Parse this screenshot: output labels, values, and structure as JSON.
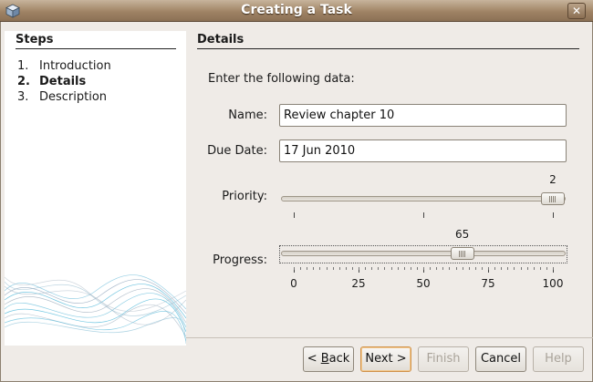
{
  "window": {
    "title": "Creating a Task",
    "close_glyph": "✕"
  },
  "steps": {
    "title": "Steps",
    "items": [
      {
        "num": "1.",
        "label": "Introduction",
        "active": false
      },
      {
        "num": "2.",
        "label": "Details",
        "active": true
      },
      {
        "num": "3.",
        "label": "Description",
        "active": false
      }
    ]
  },
  "details": {
    "title": "Details",
    "intro": "Enter the following data:",
    "name_label": "Name:",
    "name_value": "Review chapter 10",
    "due_label": "Due Date:",
    "due_value": "17 Jun 2010",
    "priority": {
      "label": "Priority:",
      "value": 2,
      "min": 0,
      "max": 2,
      "value_text": "2"
    },
    "progress": {
      "label": "Progress:",
      "value": 65,
      "min": 0,
      "max": 100,
      "value_text": "65",
      "tick_labels": [
        "0",
        "25",
        "50",
        "75",
        "100"
      ]
    }
  },
  "buttons": {
    "back": {
      "pre": "< ",
      "mnemonic": "B",
      "rest": "ack"
    },
    "next": "Next >",
    "finish": "Finish",
    "cancel": "Cancel",
    "help": "Help"
  },
  "colors": {
    "titlebar": "#a08465",
    "default_button_ring": "#d0924a",
    "wave": "#4fb6d8"
  }
}
